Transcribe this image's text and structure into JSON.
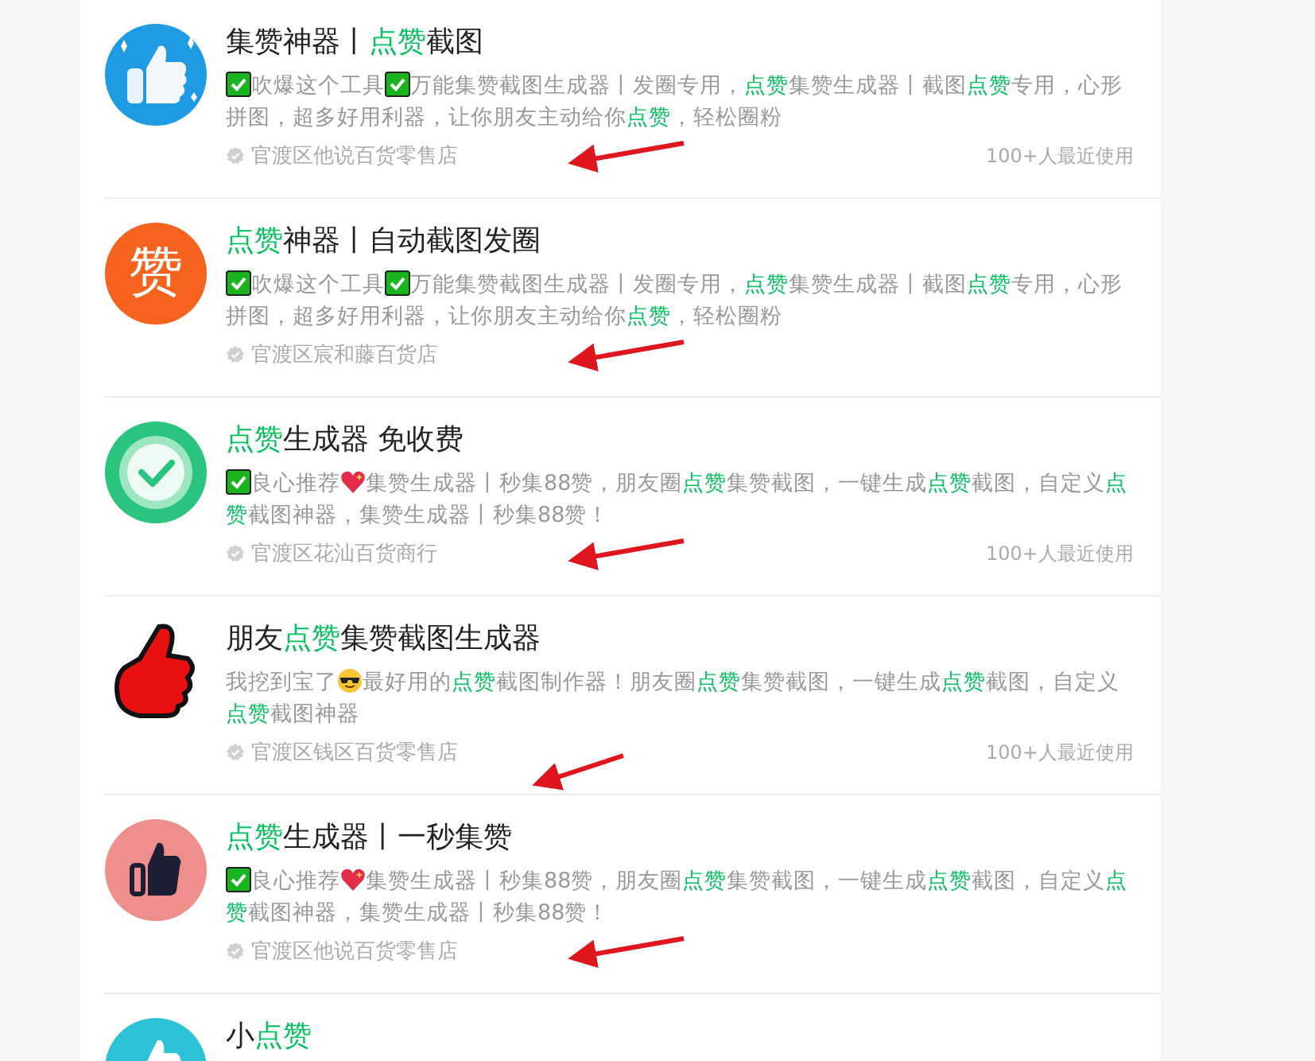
{
  "items": [
    {
      "avatar": {
        "kind": "thumb-blue"
      },
      "title": [
        {
          "text": "集赞神器丨",
          "highlight": false
        },
        {
          "text": "点赞",
          "highlight": true
        },
        {
          "text": "截图",
          "highlight": false
        }
      ],
      "description": [
        {
          "kind": "check-emoji"
        },
        {
          "kind": "text",
          "text": "吹爆这个工具"
        },
        {
          "kind": "check-emoji"
        },
        {
          "kind": "text",
          "text": "万能集赞截图生成器丨发圈专用，"
        },
        {
          "kind": "highlight",
          "text": "点赞"
        },
        {
          "kind": "text",
          "text": "集赞生成器丨截图"
        },
        {
          "kind": "highlight",
          "text": "点赞"
        },
        {
          "kind": "text",
          "text": "专用，心形拼图，超多好用利器，让你朋友主动给你"
        },
        {
          "kind": "highlight",
          "text": "点赞"
        },
        {
          "kind": "text",
          "text": "，轻松圈粉"
        }
      ],
      "shop": "官渡区他说百货零售店",
      "usage": "100+人最近使用"
    },
    {
      "avatar": {
        "kind": "char",
        "text": "赞"
      },
      "title": [
        {
          "text": "点赞",
          "highlight": true
        },
        {
          "text": "神器丨自动截图发圈",
          "highlight": false
        }
      ],
      "description": [
        {
          "kind": "check-emoji"
        },
        {
          "kind": "text",
          "text": "吹爆这个工具"
        },
        {
          "kind": "check-emoji"
        },
        {
          "kind": "text",
          "text": "万能集赞截图生成器丨发圈专用，"
        },
        {
          "kind": "highlight",
          "text": "点赞"
        },
        {
          "kind": "text",
          "text": "集赞生成器丨截图"
        },
        {
          "kind": "highlight",
          "text": "点赞"
        },
        {
          "kind": "text",
          "text": "专用，心形拼图，超多好用利器，让你朋友主动给你"
        },
        {
          "kind": "highlight",
          "text": "点赞"
        },
        {
          "kind": "text",
          "text": "，轻松圈粉"
        }
      ],
      "shop": "官渡区宸和藤百货店"
    },
    {
      "avatar": {
        "kind": "check"
      },
      "title": [
        {
          "text": "点赞",
          "highlight": true
        },
        {
          "text": "生成器 免收费",
          "highlight": false
        }
      ],
      "description": [
        {
          "kind": "check-emoji"
        },
        {
          "kind": "text",
          "text": "良心推荐"
        },
        {
          "kind": "heart-emoji"
        },
        {
          "kind": "text",
          "text": "集赞生成器丨秒集88赞，朋友圈"
        },
        {
          "kind": "highlight",
          "text": "点赞"
        },
        {
          "kind": "text",
          "text": "集赞截图，一键生成"
        },
        {
          "kind": "highlight",
          "text": "点赞"
        },
        {
          "kind": "text",
          "text": "截图，自定义"
        },
        {
          "kind": "highlight",
          "text": "点赞"
        },
        {
          "kind": "text",
          "text": "截图神器，集赞生成器丨秒集88赞！"
        }
      ],
      "shop": "官渡区花汕百货商行",
      "usage": "100+人最近使用"
    },
    {
      "avatar": {
        "kind": "red-thumb"
      },
      "title": [
        {
          "text": "朋友",
          "highlight": false
        },
        {
          "text": "点赞",
          "highlight": true
        },
        {
          "text": "集赞截图生成器",
          "highlight": false
        }
      ],
      "description": [
        {
          "kind": "text",
          "text": "我挖到宝了"
        },
        {
          "kind": "cool-emoji"
        },
        {
          "kind": "text",
          "text": "最好用的"
        },
        {
          "kind": "highlight",
          "text": "点赞"
        },
        {
          "kind": "text",
          "text": "截图制作器！朋友圈"
        },
        {
          "kind": "highlight",
          "text": "点赞"
        },
        {
          "kind": "text",
          "text": "集赞截图，一键生成"
        },
        {
          "kind": "highlight",
          "text": "点赞"
        },
        {
          "kind": "text",
          "text": "截图，自定义"
        },
        {
          "kind": "highlight",
          "text": "点赞"
        },
        {
          "kind": "text",
          "text": "截图神器"
        }
      ],
      "shop": "官渡区钱区百货零售店",
      "usage": "100+人最近使用"
    },
    {
      "avatar": {
        "kind": "thumb-pink"
      },
      "title": [
        {
          "text": "点赞",
          "highlight": true
        },
        {
          "text": "生成器丨一秒集赞",
          "highlight": false
        }
      ],
      "description": [
        {
          "kind": "check-emoji"
        },
        {
          "kind": "text",
          "text": "良心推荐"
        },
        {
          "kind": "heart-emoji"
        },
        {
          "kind": "text",
          "text": "集赞生成器丨秒集88赞，朋友圈"
        },
        {
          "kind": "highlight",
          "text": "点赞"
        },
        {
          "kind": "text",
          "text": "集赞截图，一键生成"
        },
        {
          "kind": "highlight",
          "text": "点赞"
        },
        {
          "kind": "text",
          "text": "截图，自定义"
        },
        {
          "kind": "highlight",
          "text": "点赞"
        },
        {
          "kind": "text",
          "text": "截图神器，集赞生成器丨秒集88赞！"
        }
      ],
      "shop": "官渡区他说百货零售店"
    },
    {
      "avatar": {
        "kind": "thumb-teal"
      },
      "title": [
        {
          "text": "小",
          "highlight": false
        },
        {
          "text": "点赞",
          "highlight": true
        }
      ]
    }
  ]
}
